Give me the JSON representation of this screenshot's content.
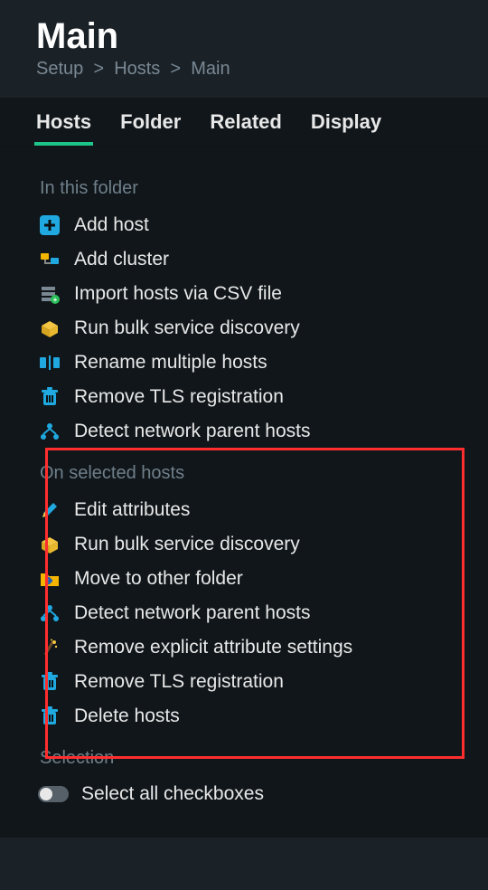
{
  "header": {
    "title": "Main",
    "breadcrumb": [
      "Setup",
      "Hosts",
      "Main"
    ]
  },
  "tabs": [
    {
      "label": "Hosts",
      "active": true
    },
    {
      "label": "Folder",
      "active": false
    },
    {
      "label": "Related",
      "active": false
    },
    {
      "label": "Display",
      "active": false
    }
  ],
  "menu": {
    "sections": [
      {
        "heading": "In this folder",
        "items": [
          {
            "label": "Add host",
            "icon": "plus-icon"
          },
          {
            "label": "Add cluster",
            "icon": "cluster-icon"
          },
          {
            "label": "Import hosts via CSV file",
            "icon": "import-icon"
          },
          {
            "label": "Run bulk service discovery",
            "icon": "box-icon"
          },
          {
            "label": "Rename multiple hosts",
            "icon": "rename-icon"
          },
          {
            "label": "Remove TLS registration",
            "icon": "trash-icon"
          },
          {
            "label": "Detect network parent hosts",
            "icon": "network-icon"
          }
        ]
      },
      {
        "heading": "On selected hosts",
        "highlighted": true,
        "items": [
          {
            "label": "Edit attributes",
            "icon": "pencil-icon"
          },
          {
            "label": "Run bulk service discovery",
            "icon": "box-icon"
          },
          {
            "label": "Move to other folder",
            "icon": "move-folder-icon"
          },
          {
            "label": "Detect network parent hosts",
            "icon": "network-icon"
          },
          {
            "label": "Remove explicit attribute settings",
            "icon": "wand-icon"
          },
          {
            "label": "Remove TLS registration",
            "icon": "trash-icon"
          },
          {
            "label": "Delete hosts",
            "icon": "trash-icon"
          }
        ]
      },
      {
        "heading": "Selection",
        "items": [
          {
            "label": "Select all checkboxes",
            "icon": "toggle-icon"
          }
        ]
      }
    ]
  },
  "colors": {
    "accent": "#1dc58b",
    "highlight_border": "#ff2e2e",
    "icon_blue": "#1fa9e0",
    "icon_yellow": "#f4b400"
  }
}
